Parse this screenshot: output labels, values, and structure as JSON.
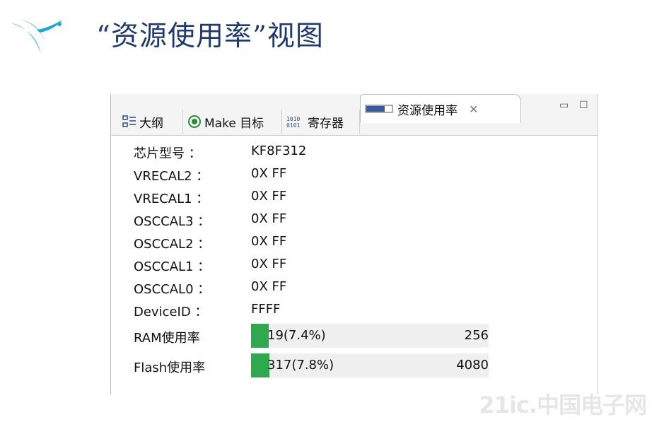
{
  "slide": {
    "title": "“资源使用率”视图"
  },
  "tabs": [
    {
      "label": "大纲",
      "icon": "outline-icon"
    },
    {
      "label": "Make 目标",
      "icon": "make-target-icon"
    },
    {
      "label": "寄存器",
      "icon": "register-icon"
    },
    {
      "label": "资源使用率",
      "icon": "resource-usage-icon",
      "active": true
    }
  ],
  "info_rows": [
    {
      "label": "芯片型号 ：",
      "value": "KF8F312"
    },
    {
      "label": "VRECAL2  ：",
      "value": "0X FF"
    },
    {
      "label": "VRECAL1  ：",
      "value": "0X FF"
    },
    {
      "label": "OSCCAL3  ：",
      "value": "0X FF"
    },
    {
      "label": "OSCCAL2  ：",
      "value": "0X FF"
    },
    {
      "label": "OSCCAL1  ：",
      "value": "0X FF"
    },
    {
      "label": "OSCCAL0  ：",
      "value": "0X FF"
    },
    {
      "label": "DeviceID ：",
      "value": "FFFF"
    }
  ],
  "usage": [
    {
      "label": "RAM使用率",
      "text": "19(7.4%)",
      "max": "256",
      "percent": 7.4
    },
    {
      "label": "Flash使用率",
      "text": "317(7.8%)",
      "max": "4080",
      "percent": 7.8
    }
  ],
  "watermark": "21ic.中国电子网",
  "colors": {
    "title": "#1f3a6b",
    "bar_fill": "#2fa84f",
    "bar_track": "#efefef"
  }
}
